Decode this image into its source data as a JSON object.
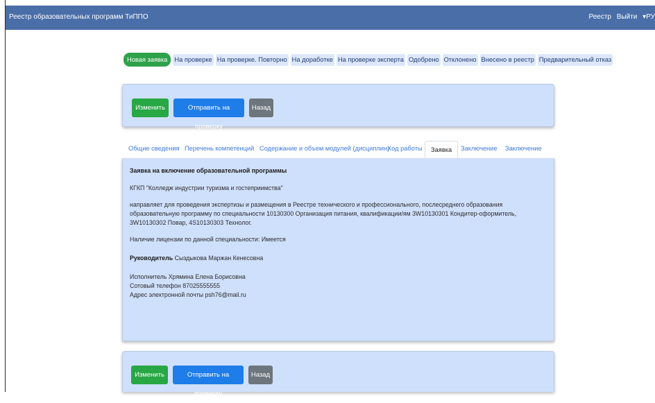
{
  "navbar": {
    "brand": "Реестр образовательных программ ТиППО",
    "links": [
      "Реестр",
      "Выйти",
      "▾РУ"
    ]
  },
  "status_tabs": [
    {
      "label": "Новая заявка",
      "active": true
    },
    {
      "label": "На проверке",
      "active": false
    },
    {
      "label": "На проверке. Повторно",
      "active": false
    },
    {
      "label": "На доработке",
      "active": false
    },
    {
      "label": "На проверке эксперта",
      "active": false
    },
    {
      "label": "Одобрено",
      "active": false
    },
    {
      "label": "Отклонено",
      "active": false
    },
    {
      "label": "Внесено в реестр",
      "active": false
    },
    {
      "label": "Предварительный отказ",
      "active": false
    }
  ],
  "actions": {
    "edit": "Изменить",
    "submit": "Отправить на проверку",
    "back": "Назад"
  },
  "content_tabs": [
    "Общие сведения",
    "Перечень компетенций",
    "Содержание и объем модулей (дисциплин)",
    "Ход работы",
    "Заявка",
    "Заключение",
    "Заключение"
  ],
  "application": {
    "title": "Заявка на включение образовательной программы",
    "org": "КГКП \"Колледж индустрии туризма и гостеприимства\"",
    "body": "направляет для проведения экспертизы и размещения в Реестре технического и профессионального, послесреднего образования образовательную программу по специальности 10130300 Организация питания, квалификации/ям 3W10130301 Кондитер-оформитель, 3W10130302 Повар, 4S10130303 Технолог.",
    "license": "Наличие лицензии по данной специальности: Имеется",
    "head_label": "Руководитель",
    "head_name": "Сыздыкова Маржан Кенесовна",
    "executor": "Исполнитель Хрямина Елена Борисовна",
    "phone": "Сотовый телефон 87025555555",
    "email": "Адрес электронной почты psh76@mail.ru"
  },
  "colors": {
    "navbar": "#4a6ea8",
    "panel": "#cfe0fc",
    "green": "#28a745",
    "blue": "#1e7de8",
    "gray": "#6d757d",
    "link": "#3e7ae0"
  }
}
